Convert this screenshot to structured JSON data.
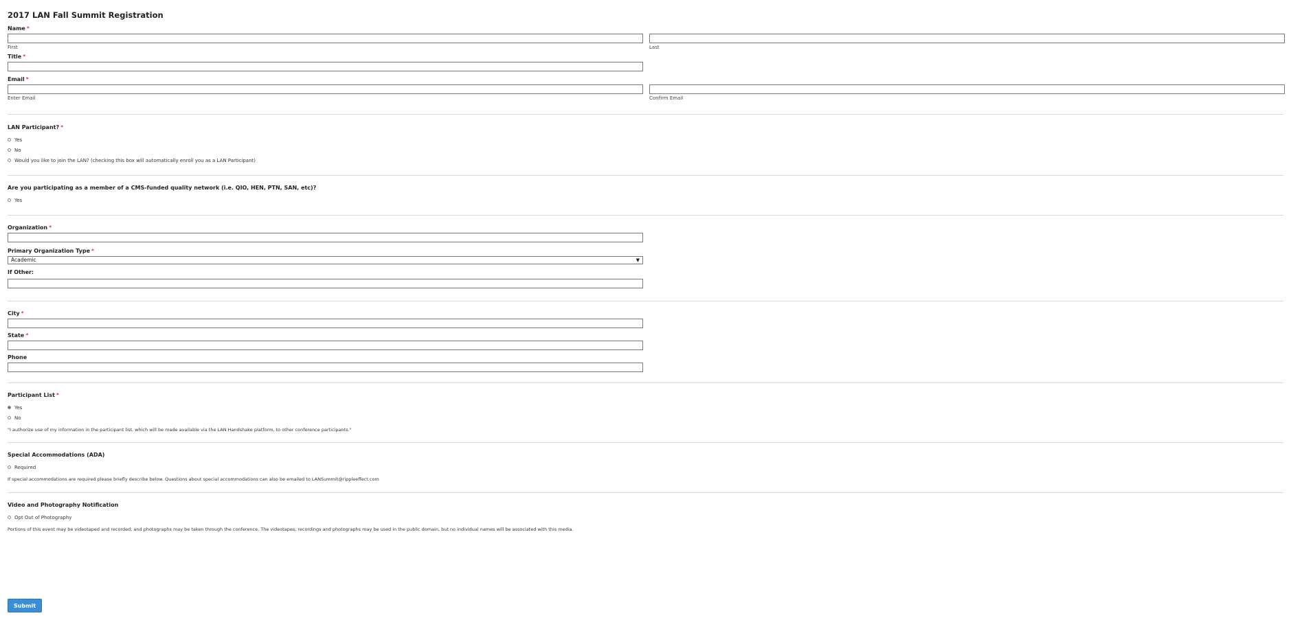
{
  "title": "2017 LAN Fall Summit Registration",
  "required_mark": "*",
  "name": {
    "label": "Name",
    "first_sublabel": "First",
    "last_sublabel": "Last"
  },
  "job_title": {
    "label": "Title"
  },
  "email": {
    "label": "Email",
    "enter_sublabel": "Enter Email",
    "confirm_sublabel": "Confirm Email"
  },
  "lan_participant": {
    "label": "LAN Participant?",
    "options": [
      "Yes",
      "No",
      "Would you like to join the LAN? (checking this box will automatically enroll you as a LAN Participant)"
    ]
  },
  "cms_network": {
    "label": "Are you participating as a member of a CMS-funded quality network (i.e. QIO, HEN, PTN, SAN, etc)?",
    "options": [
      "Yes"
    ]
  },
  "organization": {
    "label": "Organization"
  },
  "org_type": {
    "label": "Primary Organization Type",
    "selected": "Academic",
    "arrow": "▼"
  },
  "if_other": {
    "label": "If Other:"
  },
  "city": {
    "label": "City"
  },
  "state": {
    "label": "State"
  },
  "phone": {
    "label": "Phone"
  },
  "participant_list": {
    "label": "Participant List",
    "options": [
      "Yes",
      "No"
    ],
    "selected_index": 0,
    "note": "\"I authorize use of my information in the participant list, which will be made available via the LAN Handshake platform, to other conference participants.\""
  },
  "ada": {
    "label": "Special Accommodations (ADA)",
    "options": [
      "Required"
    ],
    "note": "If special accommodations are required please briefly describe below. Questions about special accommodations can also be emailed to LANSummit@rippleeffect.com"
  },
  "video": {
    "label": "Video and Photography Notification",
    "options": [
      "Opt Out of Photography"
    ],
    "note": "Portions of this event may be videotaped and recorded, and photographs may be taken through the conference. The videotapes, recordings and photographs may be used in the public domain, but no individual names will be associated with this media."
  },
  "submit": {
    "label": "Submit",
    "color": "#3a8ed8"
  }
}
